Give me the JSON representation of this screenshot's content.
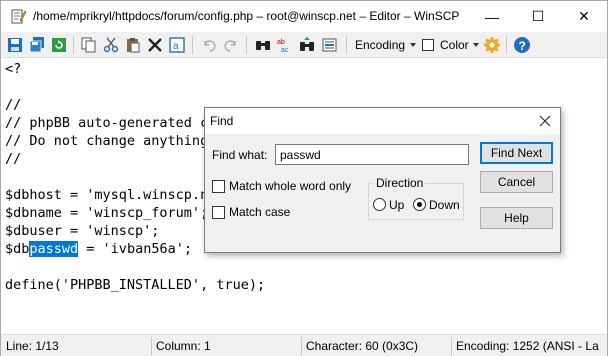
{
  "window": {
    "title": "/home/mprikryl/httpdocs/forum/config.php – root@winscp.net – Editor – WinSCP",
    "minimize_glyph": "—",
    "maximize_glyph": "☐",
    "close_glyph": "✕"
  },
  "toolbar": {
    "icons": [
      "save-icon",
      "save-all-icon",
      "reload-icon",
      "copy-icon",
      "cut-icon",
      "paste-icon",
      "delete-icon",
      "select-all-icon",
      "undo-icon",
      "redo-icon",
      "find-icon",
      "replace-icon",
      "find-next-icon",
      "go-to-line-icon"
    ],
    "encoding_label": "Encoding",
    "color_label": "Color",
    "settings_icon": "gear-icon",
    "help_icon": "help-icon"
  },
  "editor": {
    "lines": [
      "<?",
      "",
      "//",
      "// phpBB auto-generated c",
      "// Do not change anything",
      "//",
      "",
      "$dbhost = 'mysql.winscp.n",
      "$dbname = 'winscp_forum';",
      "$dbuser = 'winscp';",
      "$db",
      "",
      "define('PHPBB_INSTALLED', true);"
    ],
    "line11_selected": "passwd",
    "line11_rest": " = 'ivban56a';"
  },
  "status": {
    "line": "Line: 1/13",
    "column": "Column: 1",
    "character": "Character: 60 (0x3C)",
    "encoding": "Encoding: 1252  (ANSI - La"
  },
  "find_dialog": {
    "title": "Find",
    "find_what_label": "Find what:",
    "find_what_value": "passwd",
    "match_whole_word_label": "Match whole word only",
    "match_case_label": "Match case",
    "direction_label": "Direction",
    "up_label": "Up",
    "down_label": "Down",
    "find_next_label": "Find Next",
    "cancel_label": "Cancel",
    "help_label": "Help"
  },
  "colors": {
    "accent": "#0078d7",
    "toolbar_blue": "#1f6fbf",
    "gear_orange": "#f5a623"
  }
}
